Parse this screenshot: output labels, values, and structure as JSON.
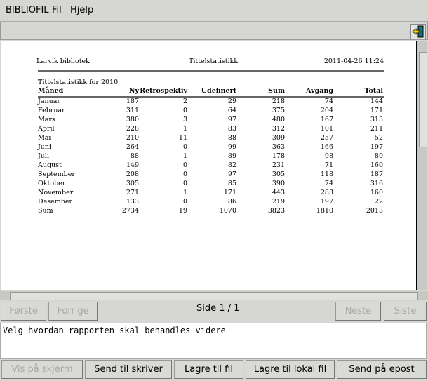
{
  "menu": {
    "items": [
      "BIBLIOFIL",
      "Fil",
      "Hjelp"
    ]
  },
  "toolbar": {
    "exit_icon": "exit-door-icon"
  },
  "report": {
    "library": "Larvik bibliotek",
    "title": "Tittelstatistikk",
    "timestamp": "2011-04-26 11:24",
    "subtitle": "Tittelstatistikk for 2010",
    "columns": [
      "Måned",
      "Ny",
      "Retrospektiv",
      "Udefinert",
      "Sum",
      "Avgang",
      "Total"
    ],
    "rows": [
      [
        "Januar",
        "187",
        "2",
        "29",
        "218",
        "74",
        "144"
      ],
      [
        "Februar",
        "311",
        "0",
        "64",
        "375",
        "204",
        "171"
      ],
      [
        "Mars",
        "380",
        "3",
        "97",
        "480",
        "167",
        "313"
      ],
      [
        "April",
        "228",
        "1",
        "83",
        "312",
        "101",
        "211"
      ],
      [
        "Mai",
        "210",
        "11",
        "88",
        "309",
        "257",
        "52"
      ],
      [
        "Juni",
        "264",
        "0",
        "99",
        "363",
        "166",
        "197"
      ],
      [
        "Juli",
        "88",
        "1",
        "89",
        "178",
        "98",
        "80"
      ],
      [
        "August",
        "149",
        "0",
        "82",
        "231",
        "71",
        "160"
      ],
      [
        "September",
        "208",
        "0",
        "97",
        "305",
        "118",
        "187"
      ],
      [
        "Oktober",
        "305",
        "0",
        "85",
        "390",
        "74",
        "316"
      ],
      [
        "November",
        "271",
        "1",
        "171",
        "443",
        "283",
        "160"
      ],
      [
        "Desember",
        "133",
        "0",
        "86",
        "219",
        "197",
        "22"
      ],
      [
        "Sum",
        "2734",
        "19",
        "1070",
        "3823",
        "1810",
        "2013"
      ]
    ]
  },
  "nav": {
    "first": "Første",
    "prev": "Forrige",
    "page": "Side 1 / 1",
    "next": "Neste",
    "last": "Siste"
  },
  "message": "Velg hvordan rapporten skal behandles videre",
  "actions": [
    "Vis på skjerm",
    "Send til skriver",
    "Lagre til fil",
    "Lagre til lokal fil",
    "Send på epost"
  ]
}
